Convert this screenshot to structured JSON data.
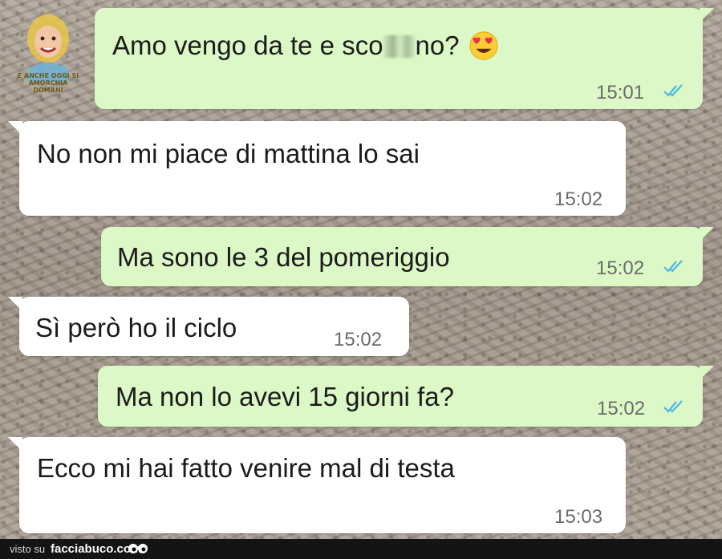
{
  "watermark": {
    "logo_caption": "E ANCHE OGGI SI AMORCHIA DOMANI"
  },
  "messages": [
    {
      "direction": "outgoing",
      "text_before": "Amo vengo da te e sco",
      "text_after": "no?",
      "redacted": true,
      "emoji": "heart-eyes-emoji",
      "time": "15:01",
      "read": true
    },
    {
      "direction": "incoming",
      "text": "No non mi piace di mattina lo sai",
      "time": "15:02"
    },
    {
      "direction": "outgoing",
      "text": "Ma sono le 3 del pomeriggio",
      "time": "15:02",
      "read": true
    },
    {
      "direction": "incoming",
      "text": "Sì però ho il ciclo",
      "time": "15:02"
    },
    {
      "direction": "outgoing",
      "text": "Ma non lo avevi 15 giorni fa?",
      "time": "15:02",
      "read": true
    },
    {
      "direction": "incoming",
      "text": "Ecco mi hai fatto venire mal di testa",
      "time": "15:03"
    }
  ],
  "colors": {
    "outgoing_bubble": "#dcf8c6",
    "incoming_bubble": "#ffffff",
    "read_ticks": "#4fb6ec",
    "footer_bg": "#141414"
  },
  "footer": {
    "visto_su": "visto su",
    "site": "facciabuco.com"
  }
}
